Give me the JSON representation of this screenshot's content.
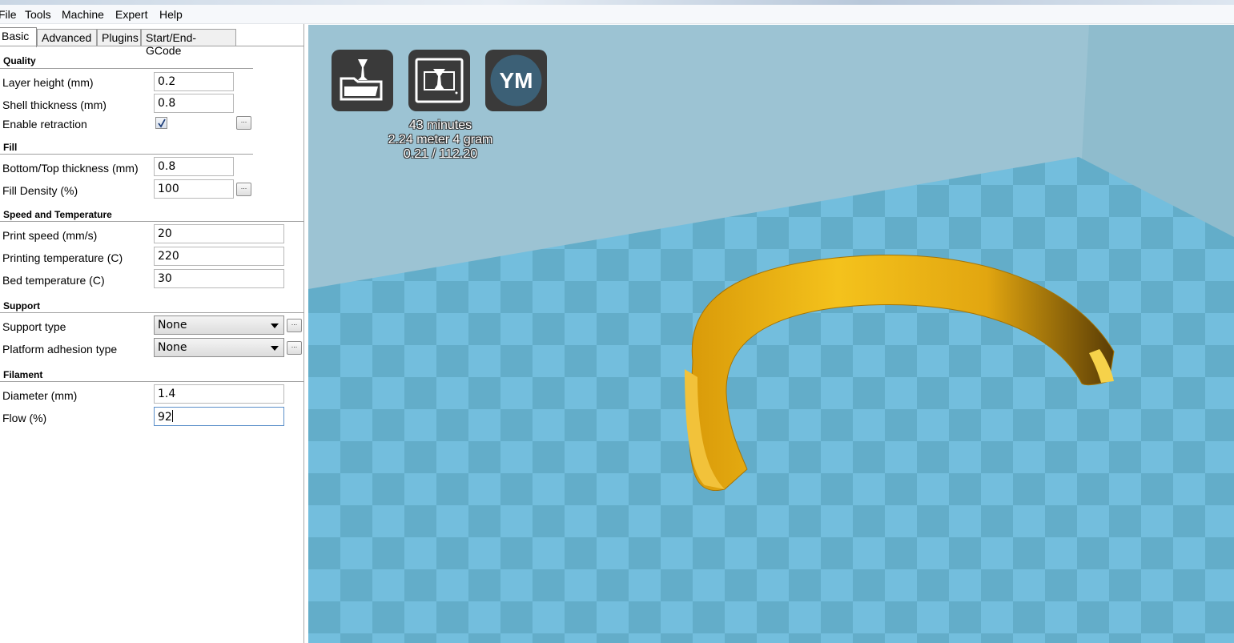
{
  "menu": [
    "File",
    "Tools",
    "Machine",
    "Expert",
    "Help"
  ],
  "tabs": [
    "Basic",
    "Advanced",
    "Plugins",
    "Start/End-GCode"
  ],
  "active_tab": "Basic",
  "quality": {
    "title": "Quality",
    "layer_height_label": "Layer height (mm)",
    "layer_height": "0.2",
    "shell_thickness_label": "Shell thickness (mm)",
    "shell_thickness": "0.8",
    "retraction_label": "Enable retraction",
    "retraction_enabled": true
  },
  "fill": {
    "title": "Fill",
    "bottom_top_label": "Bottom/Top thickness (mm)",
    "bottom_top": "0.8",
    "density_label": "Fill Density (%)",
    "density": "100"
  },
  "speed": {
    "title": "Speed and Temperature",
    "print_speed_label": "Print speed (mm/s)",
    "print_speed": "20",
    "print_temp_label": "Printing temperature (C)",
    "print_temp": "220",
    "bed_temp_label": "Bed temperature (C)",
    "bed_temp": "30"
  },
  "support": {
    "title": "Support",
    "type_label": "Support type",
    "type": "None",
    "adhesion_label": "Platform adhesion type",
    "adhesion": "None"
  },
  "filament": {
    "title": "Filament",
    "diameter_label": "Diameter (mm)",
    "diameter": "1.4",
    "flow_label": "Flow (%)",
    "flow": "92"
  },
  "more_button_label": "...",
  "viewport": {
    "buttons": [
      "load-icon",
      "print-icon",
      "ym-icon"
    ],
    "ym_label": "YM",
    "stats": [
      "43 minutes",
      "2.24 meter 4 gram",
      "0.21 / 112.20"
    ],
    "colors": {
      "background": "#9cc3d3",
      "tile_light": "#6bbadb",
      "tile_dark": "#5aa8c6",
      "model": "#e7b214"
    }
  }
}
